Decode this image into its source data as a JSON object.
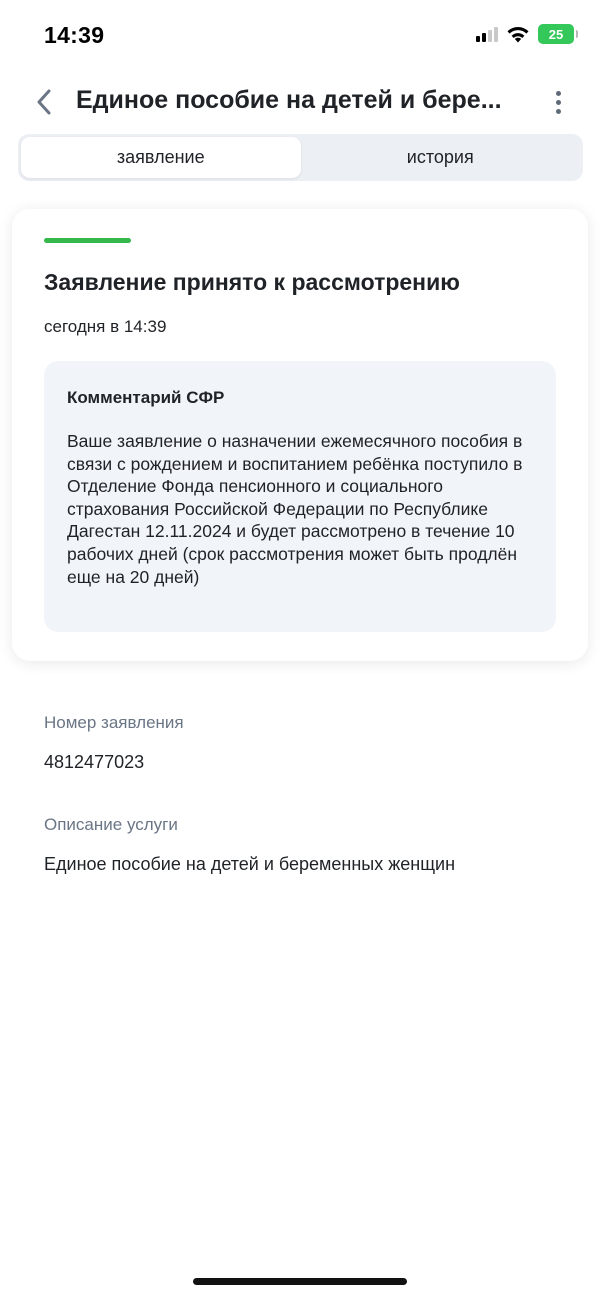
{
  "status_bar": {
    "time": "14:39",
    "battery": "25"
  },
  "header": {
    "title": "Единое пособие на детей и бере...",
    "back_icon": "chevron-left-icon",
    "more_icon": "more-vertical-icon"
  },
  "tabs": [
    {
      "label": "заявление",
      "active": true
    },
    {
      "label": "история",
      "active": false
    }
  ],
  "status_card": {
    "accent_color": "#35b84b",
    "title": "Заявление принято к рассмотрению",
    "time": "сегодня в 14:39",
    "comment": {
      "title": "Комментарий СФР",
      "text": "Ваше заявление о назначении ежемесячного пособия в связи с рождением и воспитанием ребёнка поступило в Отделение Фонда пенсионного и социального страхования Российской Федерации по Республике Дагестан 12.11.2024 и будет рассмотрено в течение 10 рабочих дней (срок рассмотрения может быть продлён еще на 20 дней)"
    }
  },
  "details": {
    "number_label": "Номер заявления",
    "number_value": "4812477023",
    "service_label": "Описание услуги",
    "service_value": "Единое пособие на детей и беременных женщин"
  }
}
